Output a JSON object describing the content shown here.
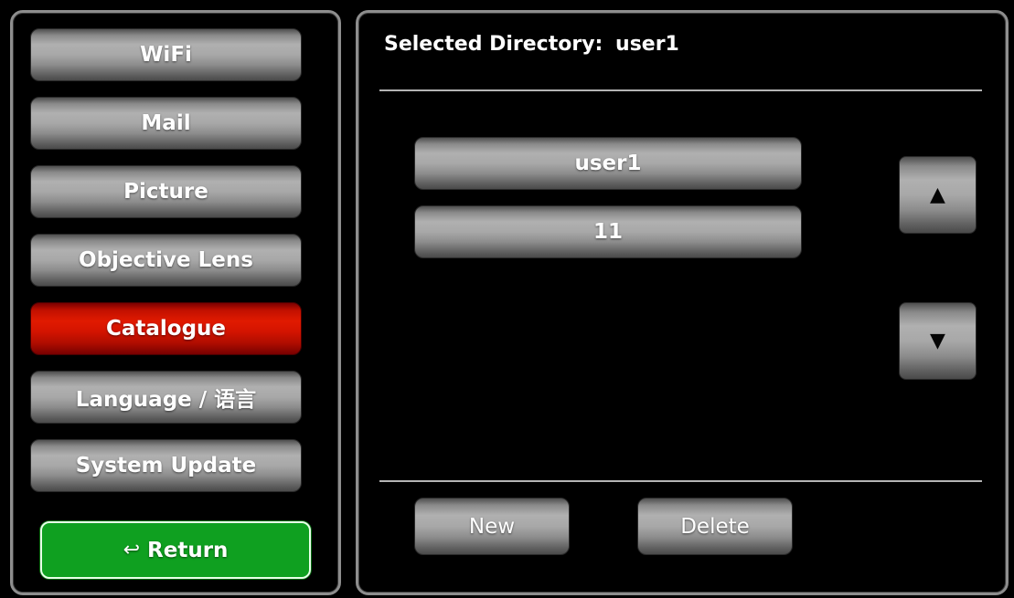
{
  "menu": {
    "items": [
      {
        "label": "WiFi",
        "active": false
      },
      {
        "label": "Mail",
        "active": false
      },
      {
        "label": "Picture",
        "active": false
      },
      {
        "label": "Objective Lens",
        "active": false
      },
      {
        "label": "Catalogue",
        "active": true
      },
      {
        "label": "Language / 语言",
        "active": false
      },
      {
        "label": "System Update",
        "active": false
      }
    ],
    "return_icon": "return-arrow-icon",
    "return_glyph": "↩",
    "return_label": "Return"
  },
  "catalogue": {
    "selected_prefix": "Selected Directory:",
    "selected_value": "user1",
    "directories": [
      "user1",
      "11"
    ],
    "scroll_up_icon": "triangle-up-icon",
    "scroll_up_glyph": "▲",
    "scroll_down_icon": "triangle-down-icon",
    "scroll_down_glyph": "▼",
    "new_label": "New",
    "delete_label": "Delete"
  },
  "colors": {
    "active_item": "#d41400",
    "return_button": "#0fa020",
    "button_gray": "#a8a8a8",
    "panel_border": "#8e8e8e"
  }
}
